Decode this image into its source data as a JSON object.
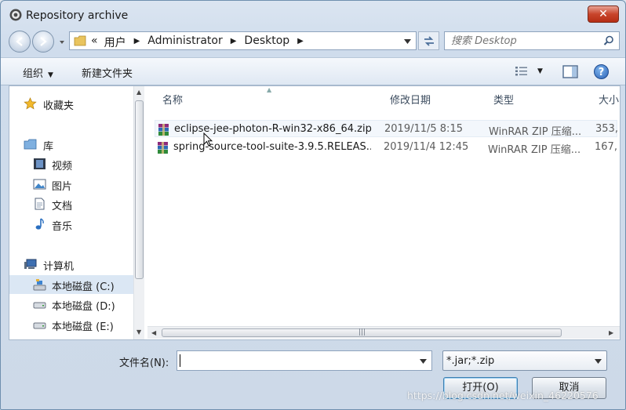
{
  "window": {
    "title": "Repository archive",
    "close_label": "✕"
  },
  "address": {
    "prefix": "«",
    "crumbs": [
      "用户",
      "Administrator",
      "Desktop"
    ]
  },
  "search": {
    "placeholder": "搜索 Desktop"
  },
  "toolbar": {
    "organize": "组织",
    "new_folder": "新建文件夹",
    "help": "?"
  },
  "nav": {
    "items": [
      {
        "label": "收藏夹",
        "icon": "star-icon"
      },
      {
        "label": "库",
        "icon": "library-icon"
      },
      {
        "label": "视频",
        "icon": "video-icon"
      },
      {
        "label": "图片",
        "icon": "picture-icon"
      },
      {
        "label": "文档",
        "icon": "document-icon"
      },
      {
        "label": "音乐",
        "icon": "music-icon"
      },
      {
        "label": "计算机",
        "icon": "computer-icon"
      },
      {
        "label": "本地磁盘 (C:)",
        "icon": "drive-c-icon"
      },
      {
        "label": "本地磁盘 (D:)",
        "icon": "drive-icon"
      },
      {
        "label": "本地磁盘 (E:)",
        "icon": "drive-icon"
      }
    ]
  },
  "columns": {
    "name": "名称",
    "date": "修改日期",
    "type": "类型",
    "size": "大小"
  },
  "files": [
    {
      "name": "eclipse-jee-photon-R-win32-x86_64.zip",
      "date": "2019/11/5 8:15",
      "type": "WinRAR ZIP 压缩...",
      "size": "353,"
    },
    {
      "name": "spring-source-tool-suite-3.9.5.RELEAS...",
      "date": "2019/11/4 12:45",
      "type": "WinRAR ZIP 压缩...",
      "size": "167,"
    }
  ],
  "bottom": {
    "filename_label": "文件名(N):",
    "filename_value": "",
    "filter_value": "*.jar;*.zip",
    "open_label": "打开(O)",
    "cancel_label": "取消"
  },
  "watermark": "https://blog.csdn.net/weixin_46220576",
  "colors": {
    "accent": "#3c7fb1",
    "close": "#c8452b",
    "selected_nav": "#dbe7f4"
  }
}
